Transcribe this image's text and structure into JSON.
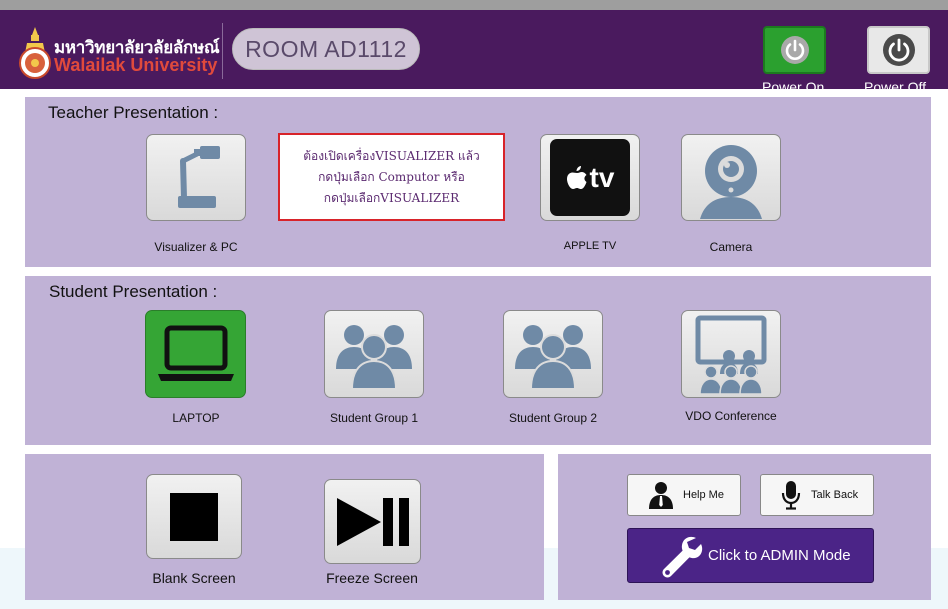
{
  "header": {
    "logo_thai": "มหาวิทยาลัยวลัยลักษณ์",
    "logo_english": "Walailak University",
    "room": "ROOM AD1112",
    "power_on_label": "Power On",
    "power_off_label": "Power Off"
  },
  "teacher": {
    "title": "Teacher Presentation :",
    "visualizer_label": "Visualizer & PC",
    "notice_lines": [
      "ต้องเปิดเครื่องVISUALIZER  แล้ว",
      "กดปุ่มเลือก Computor หรือ",
      "กดปุ่มเลือกVISUALIZER"
    ],
    "appletv_label": "APPLE TV",
    "appletv_logo_text": "tv",
    "camera_label": "Camera"
  },
  "student": {
    "title": "Student Presentation :",
    "laptop_label": "LAPTOP",
    "group1_label": "Student Group 1",
    "group2_label": "Student Group 2",
    "vdo_label": "VDO Conference"
  },
  "controls": {
    "blank_label": "Blank Screen",
    "freeze_label": "Freeze Screen"
  },
  "support": {
    "help_label": "Help Me",
    "talk_label": "Talk Back",
    "admin_label": "Click to ADMIN Mode"
  },
  "colors": {
    "header_bg": "#4a1a5e",
    "panel_bg": "#c0b2d6",
    "power_on_active": "#2ba02f",
    "laptop_selected": "#35a535",
    "admin_button": "#4b2487",
    "notice_border": "#d8232a"
  },
  "icons": {
    "power_on": "power-icon",
    "power_off": "power-icon",
    "visualizer": "document-camera-icon",
    "appletv": "apple-tv-icon",
    "camera": "webcam-icon",
    "laptop": "laptop-icon",
    "group": "people-group-icon",
    "vdo": "video-conference-icon",
    "blank": "stop-square-icon",
    "freeze": "play-pause-icon",
    "help": "person-icon",
    "talk": "microphone-icon",
    "admin": "wrench-icon"
  }
}
